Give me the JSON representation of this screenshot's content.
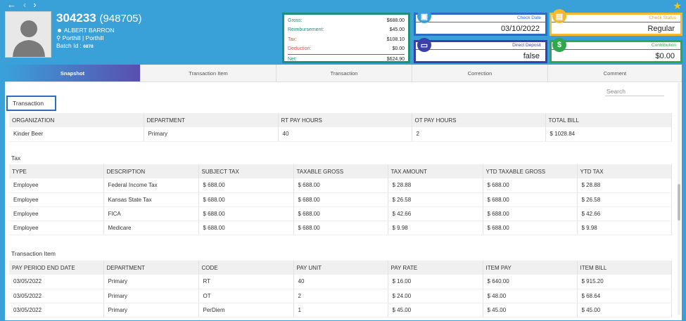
{
  "nav": {
    "back": "←",
    "prev": "‹",
    "next": "›",
    "star": "★"
  },
  "employee": {
    "id": "304233",
    "alt_id": "(948705)",
    "name": "ALBERT BARRON",
    "location": "Porthill  | Porthill",
    "batch_label": "Batch Id :",
    "batch_id": "6878"
  },
  "summary": {
    "gross_label": "Gross:",
    "gross": "$688.00",
    "reimb_label": "Reimbursement:",
    "reimb": "$45.00",
    "tax_label": "Tax:",
    "tax": "$108.10",
    "deduction_label": "Deduction:",
    "deduction": "$0.00",
    "net_label": "Net:",
    "net": "$624.90"
  },
  "cards": {
    "check_date_label": "Check Date",
    "check_date": "03/10/2022",
    "check_status_label": "Check Status",
    "check_status": "Regular",
    "direct_deposit_label": "Direct Deposit",
    "direct_deposit": "false",
    "contribution_label": "Contribution",
    "contribution": "$0.00",
    "contribution_icon": "$"
  },
  "tabs": [
    "Snapshot",
    "Transaction Item",
    "Transaction",
    "Correction",
    "Comment"
  ],
  "search": {
    "placeholder": "Search"
  },
  "transaction": {
    "title": "Transaction",
    "headers": [
      "ORGANIZATION",
      "DEPARTMENT",
      "RT PAY HOURS",
      "OT PAY HOURS",
      "TOTAL BILL"
    ],
    "rows": [
      [
        "Kinder Beer",
        "Primary",
        "40",
        "2",
        "$ 1028.84"
      ]
    ]
  },
  "tax": {
    "title": "Tax",
    "headers": [
      "TYPE",
      "DESCRIPTION",
      "SUBJECT TAX",
      "TAXABLE GROSS",
      "TAX AMOUNT",
      "YTD TAXABLE GROSS",
      "YTD TAX"
    ],
    "rows": [
      [
        "Employee",
        "Federal Income Tax",
        "$ 688.00",
        "$ 688.00",
        "$ 28.88",
        "$ 688.00",
        "$ 28.88"
      ],
      [
        "Employee",
        "Kansas State Tax",
        "$ 688.00",
        "$ 688.00",
        "$ 26.58",
        "$ 688.00",
        "$ 26.58"
      ],
      [
        "Employee",
        "FICA",
        "$ 688.00",
        "$ 688.00",
        "$ 42.66",
        "$ 688.00",
        "$ 42.66"
      ],
      [
        "Employee",
        "Medicare",
        "$ 688.00",
        "$ 688.00",
        "$ 9.98",
        "$ 688.00",
        "$ 9.98"
      ]
    ]
  },
  "transaction_item": {
    "title": "Transaction Item",
    "headers": [
      "PAY PERIOD END DATE",
      "DEPARTMENT",
      "CODE",
      "PAY UNIT",
      "PAY RATE",
      "ITEM PAY",
      "ITEM BILL"
    ],
    "rows": [
      [
        "03/05/2022",
        "Primary",
        "RT",
        "40",
        "$ 16.00",
        "$ 640.00",
        "$ 915.20"
      ],
      [
        "03/05/2022",
        "Primary",
        "OT",
        "2",
        "$ 24.00",
        "$ 48.00",
        "$ 68.64"
      ],
      [
        "03/05/2022",
        "Primary",
        "PerDiem",
        "1",
        "$ 45.00",
        "$ 45.00",
        "$ 45.00"
      ]
    ]
  }
}
